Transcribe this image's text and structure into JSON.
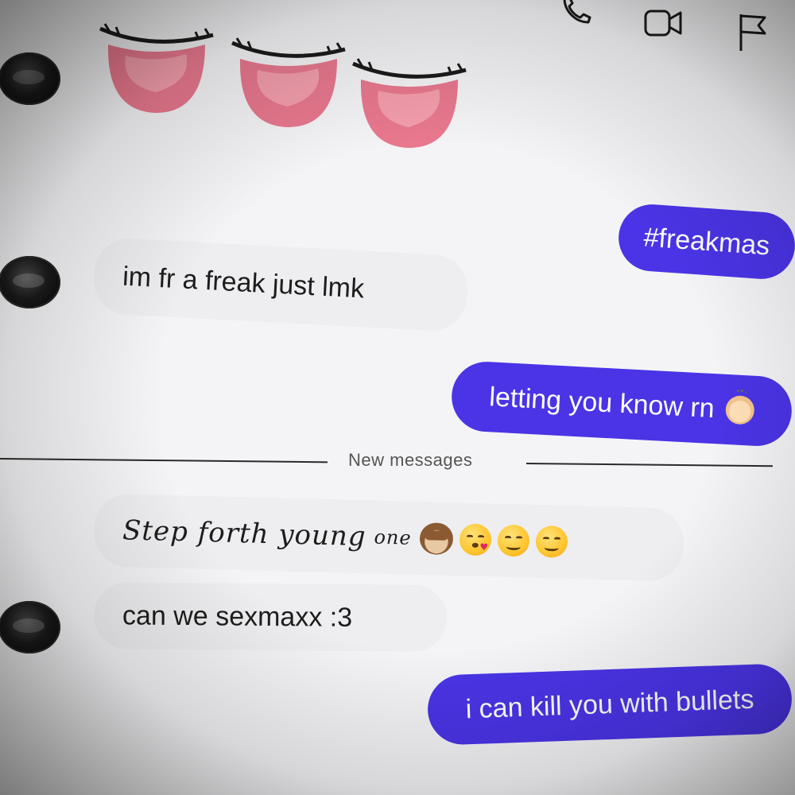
{
  "messages": [
    {
      "id": "m1",
      "direction": "out",
      "text": "#freakmas"
    },
    {
      "id": "m2",
      "direction": "in",
      "text": "im fr a freak just lmk"
    },
    {
      "id": "m3",
      "direction": "out",
      "text": "letting you know rn"
    },
    {
      "id": "m4",
      "direction": "in",
      "text_main": "Step forth young",
      "text_small": "one"
    },
    {
      "id": "m5",
      "direction": "in",
      "text": "can we sexmaxx :3"
    },
    {
      "id": "m6",
      "direction": "out",
      "text": "i can kill you with bullets"
    }
  ],
  "divider": {
    "label": "New messages"
  },
  "header_icons": [
    "phone-icon",
    "video-camera-icon",
    "flag-icon"
  ],
  "colors": {
    "outgoing_bubble": "#4a34e6",
    "incoming_bubble": "#eeeef0",
    "background": "#f4f4f6"
  }
}
